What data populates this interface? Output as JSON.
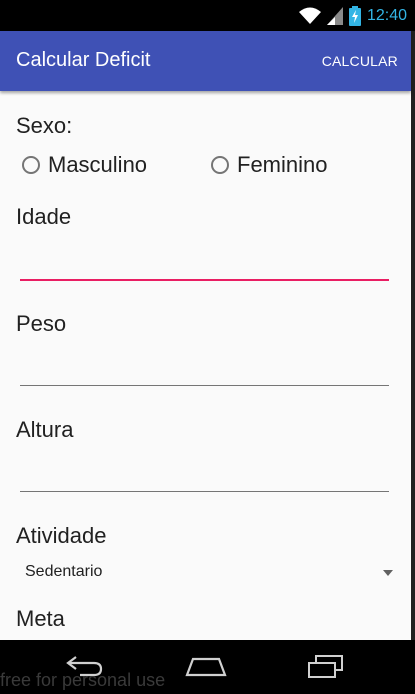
{
  "status_bar": {
    "time": "12:40",
    "icons": [
      "wifi-icon",
      "signal-icon",
      "battery-charging-icon"
    ],
    "accent_color": "#33b5e5"
  },
  "toolbar": {
    "title": "Calcular Deficit",
    "action_label": "CALCULAR",
    "color": "#3f51b5"
  },
  "form": {
    "sexo": {
      "label": "Sexo:",
      "options": [
        "Masculino",
        "Feminino"
      ],
      "selected": null
    },
    "idade": {
      "label": "Idade",
      "value": "",
      "focused": true,
      "focus_color": "#e91e63"
    },
    "peso": {
      "label": "Peso",
      "value": ""
    },
    "altura": {
      "label": "Altura",
      "value": ""
    },
    "atividade": {
      "label": "Atividade",
      "selected": "Sedentario"
    },
    "meta": {
      "label": "Meta"
    }
  },
  "nav_bar": {
    "icons": [
      "back-icon",
      "home-icon",
      "recent-apps-icon"
    ]
  },
  "watermark": {
    "text": "free for personal use"
  }
}
